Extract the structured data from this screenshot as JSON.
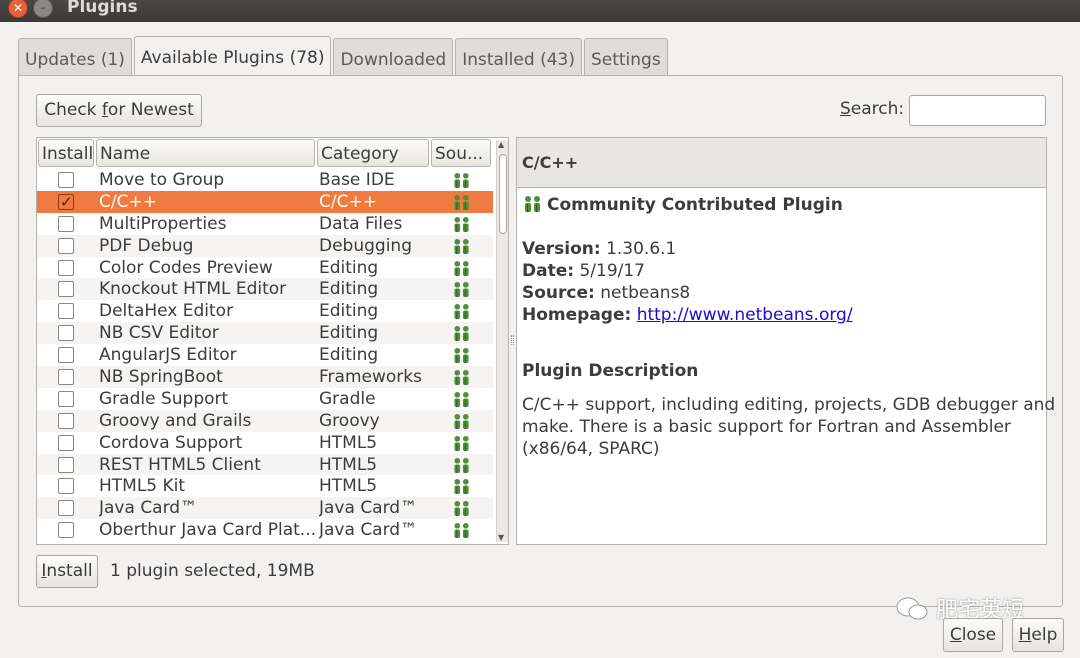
{
  "window": {
    "title": "Plugins"
  },
  "tabs": [
    {
      "label": "Updates (1)"
    },
    {
      "label": "Available Plugins (78)"
    },
    {
      "label": "Downloaded"
    },
    {
      "label": "Installed (43)"
    },
    {
      "label": "Settings"
    }
  ],
  "toolbar": {
    "check_prefix": "Check ",
    "check_mnemonic": "f",
    "check_suffix": "or Newest",
    "search_mnemonic": "S",
    "search_rest": "earch:",
    "search_value": ""
  },
  "table": {
    "headers": {
      "install": "Install",
      "name": "Name",
      "category": "Category",
      "source": "Sou..."
    },
    "rows": [
      {
        "name": "Move to Group",
        "category": "Base IDE",
        "checked": false
      },
      {
        "name": "C/C++",
        "category": "C/C++",
        "checked": true
      },
      {
        "name": "MultiProperties",
        "category": "Data Files",
        "checked": false
      },
      {
        "name": "PDF Debug",
        "category": "Debugging",
        "checked": false
      },
      {
        "name": "Color Codes Preview",
        "category": "Editing",
        "checked": false
      },
      {
        "name": "Knockout HTML Editor",
        "category": "Editing",
        "checked": false
      },
      {
        "name": "DeltaHex Editor",
        "category": "Editing",
        "checked": false
      },
      {
        "name": "NB CSV Editor",
        "category": "Editing",
        "checked": false
      },
      {
        "name": "AngularJS Editor",
        "category": "Editing",
        "checked": false
      },
      {
        "name": "NB SpringBoot",
        "category": "Frameworks",
        "checked": false
      },
      {
        "name": "Gradle Support",
        "category": "Gradle",
        "checked": false
      },
      {
        "name": "Groovy and Grails",
        "category": "Groovy",
        "checked": false
      },
      {
        "name": "Cordova Support",
        "category": "HTML5",
        "checked": false
      },
      {
        "name": "REST HTML5 Client",
        "category": "HTML5",
        "checked": false
      },
      {
        "name": "HTML5 Kit",
        "category": "HTML5",
        "checked": false
      },
      {
        "name": "Java Card™",
        "category": "Java Card™",
        "checked": false
      },
      {
        "name": "Oberthur Java Card Plat...",
        "category": "Java Card™",
        "checked": false
      }
    ]
  },
  "detail": {
    "title": "C/C++",
    "badge": "Community Contributed Plugin",
    "version_label": "Version:",
    "version": "1.30.6.1",
    "date_label": "Date:",
    "date": "5/19/17",
    "source_label": "Source:",
    "source": "netbeans8",
    "homepage_label": "Homepage:",
    "homepage": "http://www.netbeans.org/",
    "desc_heading": "Plugin Description",
    "desc_lines": [
      "C/C++ support, including editing, projects, GDB debugger and",
      "make. There is a basic support for Fortran and Assembler",
      "(x86/64, SPARC)"
    ]
  },
  "footer": {
    "install_mnemonic": "I",
    "install_rest": "nstall",
    "status": "1 plugin selected, 19MB",
    "close_mnemonic": "C",
    "close_rest": "lose",
    "help_mnemonic": "H",
    "help_rest": "elp"
  },
  "watermark": "肥宅英短",
  "colors": {
    "selection": "#ef7b41",
    "link": "#1a0dcc"
  },
  "icons": {
    "source": "community-plugin-icon"
  }
}
